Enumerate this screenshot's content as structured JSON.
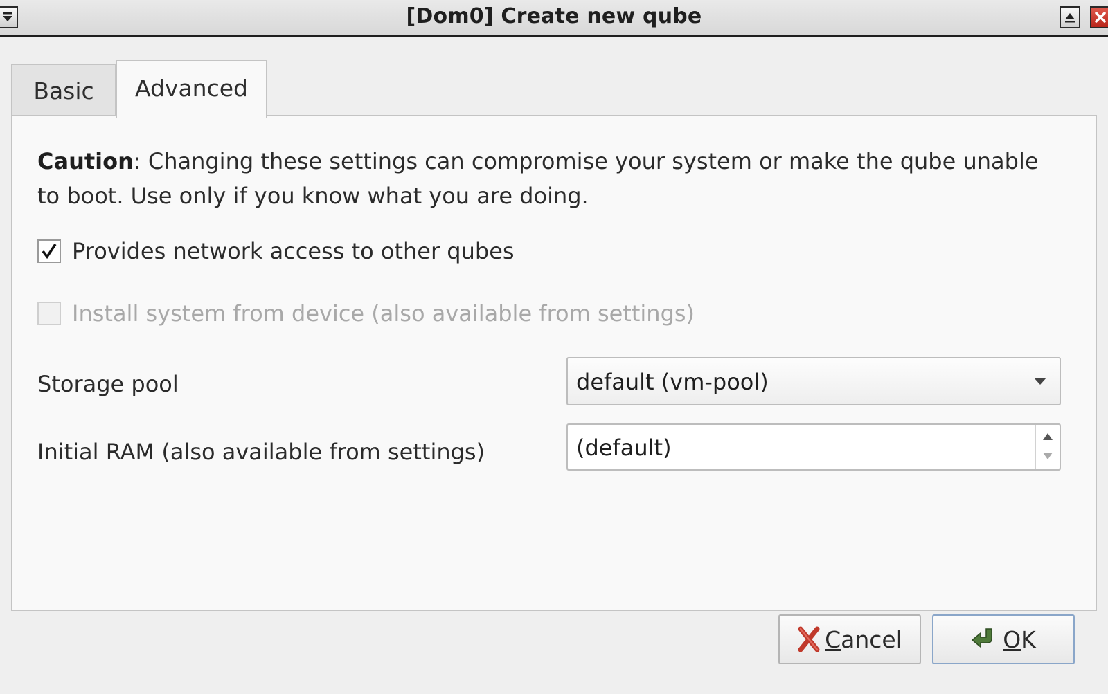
{
  "window": {
    "title": "[Dom0] Create new qube"
  },
  "tabs": [
    {
      "label": "Basic",
      "active": false
    },
    {
      "label": "Advanced",
      "active": true
    }
  ],
  "caution": {
    "bold": "Caution",
    "text": ": Changing these settings can compromise your system or make the qube unable to boot. Use only if you know what you are doing."
  },
  "options": {
    "network": {
      "label": "Provides network access to other qubes",
      "checked": true,
      "enabled": true
    },
    "install": {
      "label": "Install system from device (also available from settings)",
      "checked": false,
      "enabled": false
    }
  },
  "storage_pool": {
    "label": "Storage pool",
    "value": "default (vm-pool)"
  },
  "initial_ram": {
    "label": "Initial RAM (also available from settings)",
    "value": "(default)"
  },
  "buttons": {
    "cancel": {
      "mnemonic": "C",
      "rest": "ancel"
    },
    "ok": {
      "mnemonic": "O",
      "rest": "K"
    }
  },
  "colors": {
    "cancel_icon": "#c0392b",
    "ok_icon": "#4f7a3a",
    "ok_border": "#8aa6c9"
  }
}
